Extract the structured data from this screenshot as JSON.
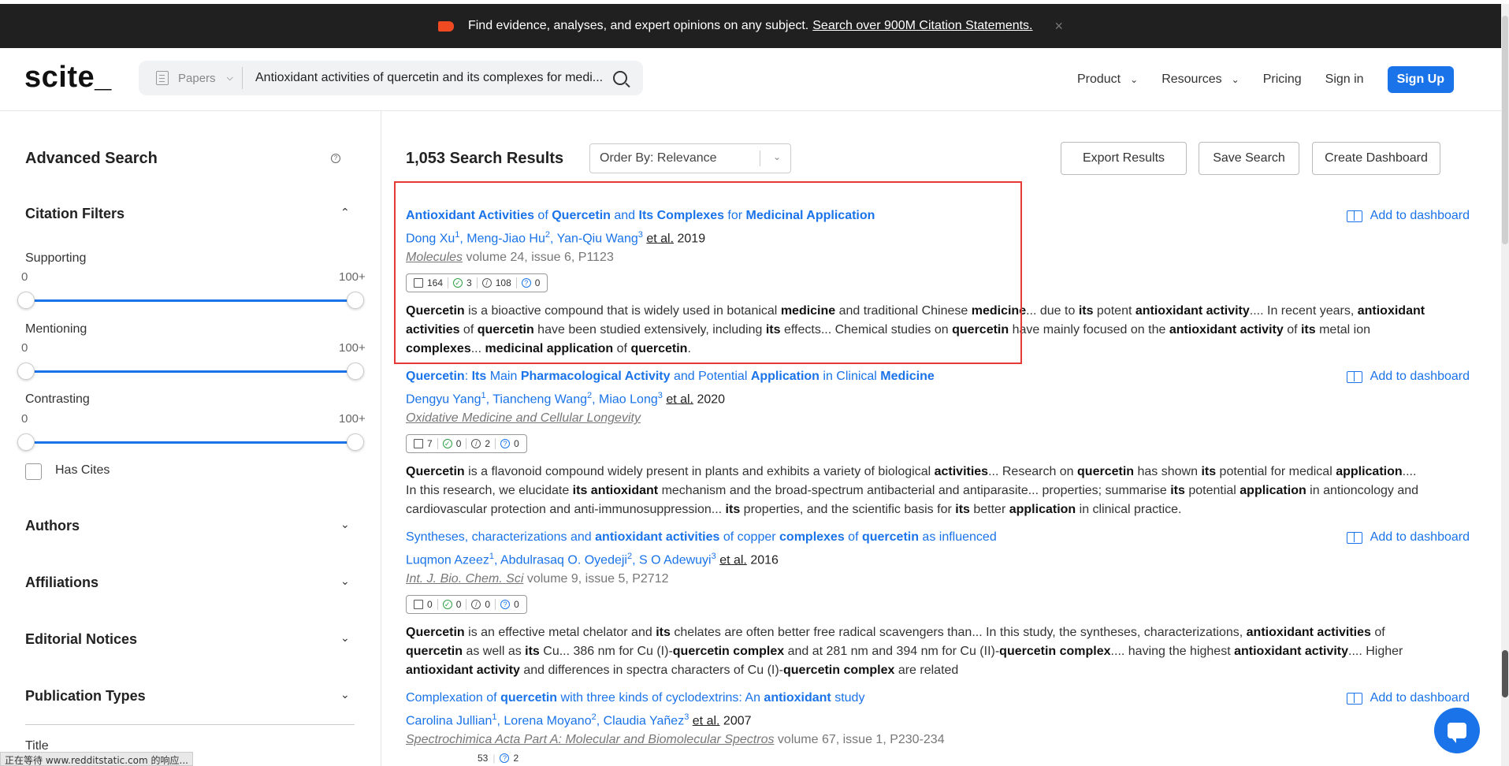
{
  "banner": {
    "text": "Find evidence, analyses, and expert opinions on any subject.",
    "link": "Search over 900M Citation Statements.",
    "close": "×"
  },
  "header": {
    "logo": "scite_",
    "search_scope": "Papers",
    "search_query": "Antioxidant activities of quercetin and its complexes for medi...",
    "nav": {
      "product": "Product",
      "resources": "Resources",
      "pricing": "Pricing",
      "signin": "Sign in",
      "signup": "Sign Up"
    }
  },
  "sidebar": {
    "title": "Advanced Search",
    "citation_filters": "Citation Filters",
    "filters": [
      {
        "label": "Supporting",
        "min": "0",
        "max": "100+"
      },
      {
        "label": "Mentioning",
        "min": "0",
        "max": "100+"
      },
      {
        "label": "Contrasting",
        "min": "0",
        "max": "100+"
      }
    ],
    "has_cites": "Has Cites",
    "sections": [
      "Authors",
      "Affiliations",
      "Editorial Notices",
      "Publication Types"
    ],
    "title_filter": "Title"
  },
  "main": {
    "results_count": "1,053 Search Results",
    "order_by": "Order By: Relevance",
    "buttons": {
      "export": "Export Results",
      "save": "Save Search",
      "dashboard": "Create Dashboard"
    },
    "add_to_dashboard": "Add to dashboard",
    "results": [
      {
        "authors": [
          "Dong Xu",
          "Meng-Jiao Hu",
          "Yan-Qiu Wang"
        ],
        "etal": "et al.",
        "year": "2019",
        "journal": "Molecules",
        "journal_details": " volume 24, issue 6, P1123",
        "counts": {
          "publications": "164",
          "supporting": "3",
          "mentioning": "108",
          "contrasting": "0"
        }
      },
      {
        "authors": [
          "Dengyu Yang",
          "Tiancheng Wang",
          "Miao Long"
        ],
        "etal": "et al.",
        "year": "2020",
        "journal": "Oxidative Medicine and Cellular Longevity",
        "journal_details": "",
        "counts": {
          "publications": "7",
          "supporting": "0",
          "mentioning": "2",
          "contrasting": "0"
        }
      },
      {
        "authors": [
          "Luqmon Azeez",
          "Abdulrasaq O. Oyedeji",
          "S O Adewuyi"
        ],
        "etal": "et al.",
        "year": "2016",
        "journal": "Int. J. Bio. Chem. Sci",
        "journal_details": " volume 9, issue 5, P2712",
        "counts": {
          "publications": "0",
          "supporting": "0",
          "mentioning": "0",
          "contrasting": "0"
        }
      },
      {
        "authors": [
          "Carolina Jullian",
          "Lorena Moyano",
          "Claudia Yañez"
        ],
        "etal": "et al.",
        "year": "2007",
        "journal": "Spectrochimica Acta Part A: Molecular and Biomolecular Spectros",
        "journal_details": " volume 67, issue 1, P230-234",
        "counts": {
          "publications": "",
          "supporting": "",
          "mentioning": "53",
          "contrasting": "2"
        }
      }
    ]
  },
  "status_bar": "正在等待 www.redditstatic.com 的响应..."
}
